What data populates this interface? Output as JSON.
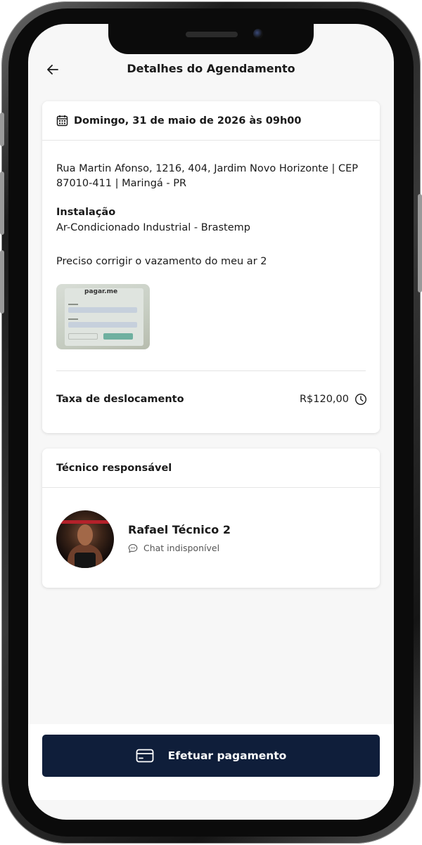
{
  "header": {
    "title": "Detalhes do Agendamento",
    "back_icon": "arrow-left-icon"
  },
  "appointment": {
    "datetime": "Domingo, 31 de maio de 2026 às 09h00",
    "address": "Rua Martin Afonso, 1216, 404, Jardim Novo Horizonte | CEP 87010-411 | Maringá - PR",
    "service_label": "Instalação",
    "service_value": "Ar-Condicionado Industrial - Brastemp",
    "description": "Preciso corrigir o vazamento do meu ar 2",
    "attachment_brand": "pagar.me",
    "fee_label": "Taxa de deslocamento",
    "fee_value": "R$120,00"
  },
  "technician": {
    "section_title": "Técnico responsável",
    "name": "Rafael Técnico 2",
    "chat_status": "Chat indisponível"
  },
  "footer": {
    "pay_label": "Efetuar pagamento"
  },
  "colors": {
    "primary": "#0f1e3a",
    "background": "#f7f7f7",
    "card": "#ffffff"
  }
}
